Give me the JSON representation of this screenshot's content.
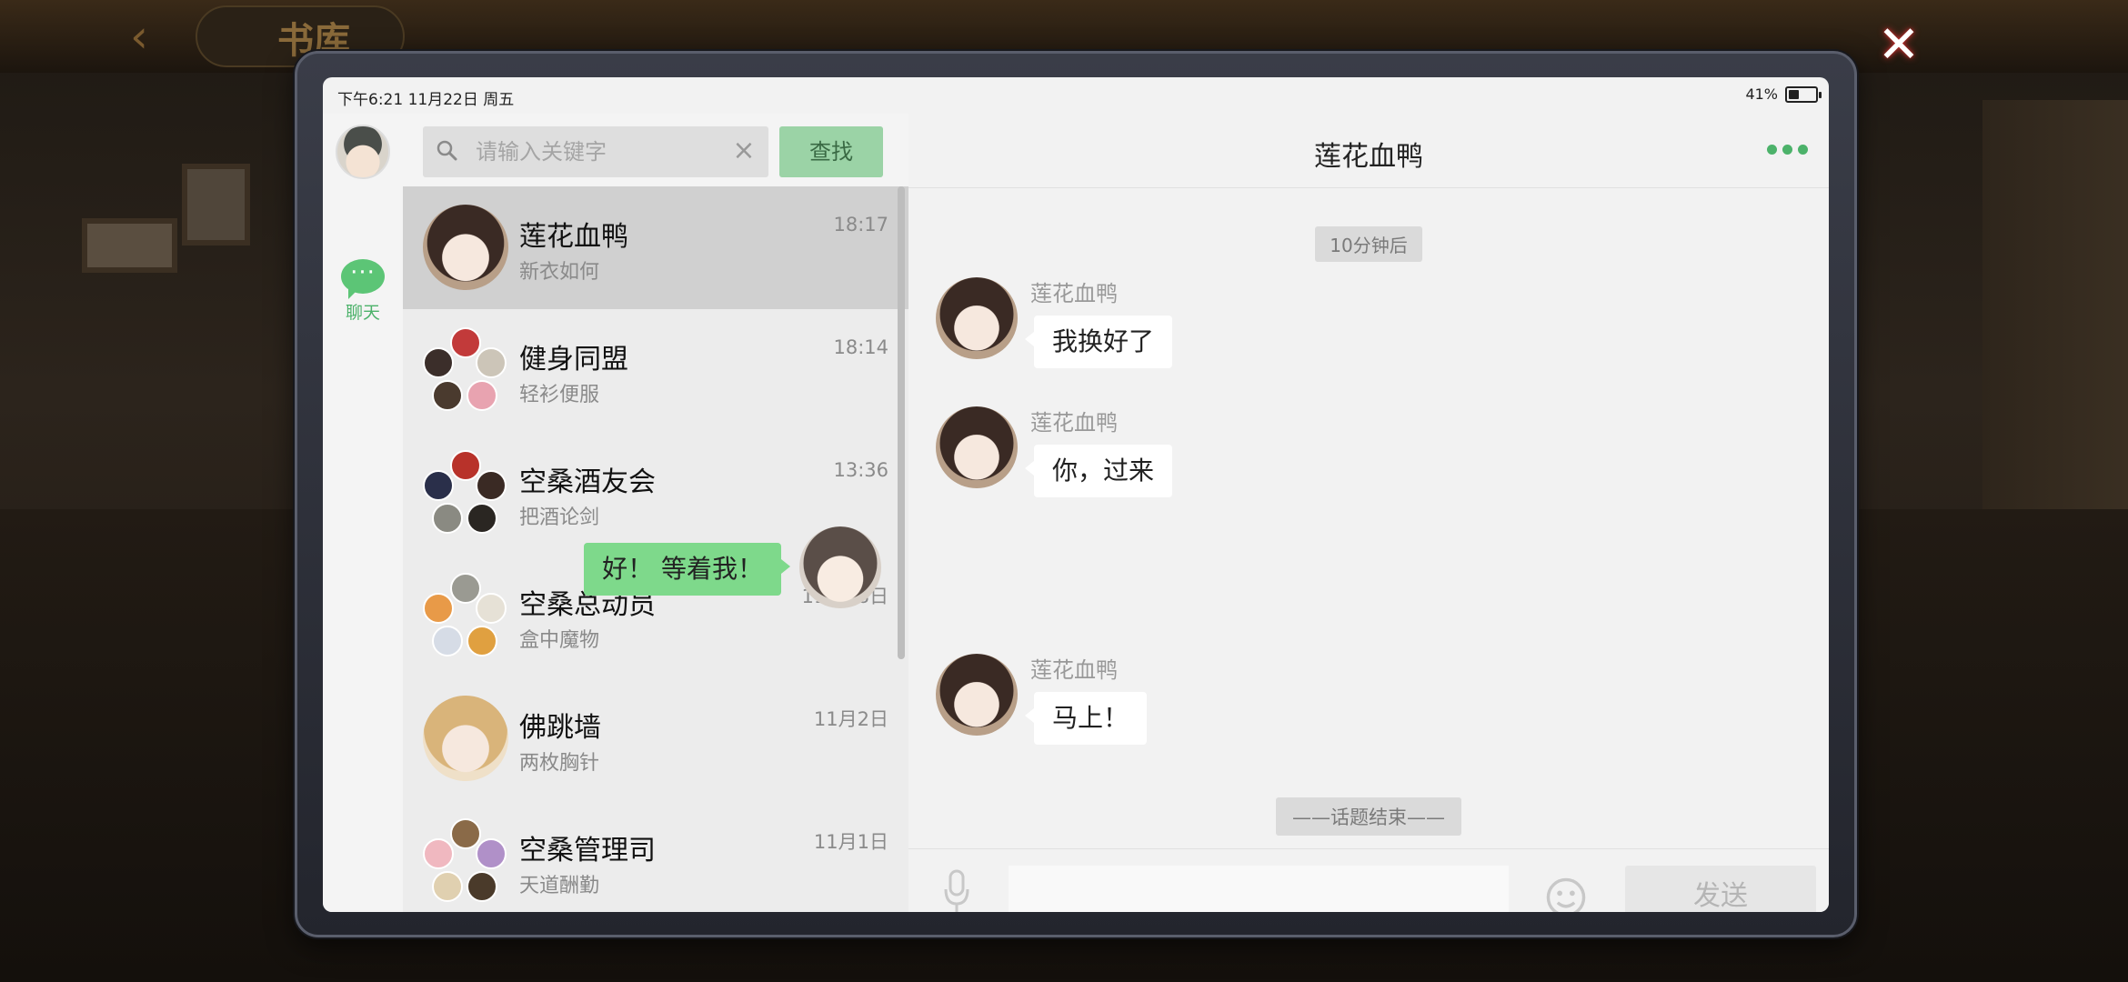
{
  "background": {
    "title": "书库"
  },
  "status": {
    "time": "下午6:21  11月22日  周五",
    "battery": "41%",
    "battery_level": 0.41
  },
  "rail": {
    "chat_label": "聊天"
  },
  "search": {
    "placeholder": "请输入关键字",
    "button": "查找"
  },
  "conversations": [
    {
      "name": "莲花血鸭",
      "preview": "新衣如何",
      "time": "18:17",
      "active": true
    },
    {
      "name": "健身同盟",
      "preview": "轻衫便服",
      "time": "18:14"
    },
    {
      "name": "空桑酒友会",
      "preview": "把酒论剑",
      "time": "13:36"
    },
    {
      "name": "空桑总动员",
      "preview": "盒中魔物",
      "time": "11月18日"
    },
    {
      "name": "佛跳墙",
      "preview": "两枚胸针",
      "time": "11月2日"
    },
    {
      "name": "空桑管理司",
      "preview": "天道酬勤",
      "time": "11月1日"
    }
  ],
  "chat": {
    "title": "莲花血鸭",
    "time_separator": "10分钟后",
    "messages": [
      {
        "from": "莲花血鸭",
        "text": "我换好了",
        "side": "left"
      },
      {
        "from": "莲花血鸭",
        "text": "你，过来",
        "side": "left"
      },
      {
        "from": "me",
        "text": "好！ 等着我！",
        "side": "right"
      },
      {
        "from": "莲花血鸭",
        "text": "马上！",
        "side": "left"
      }
    ],
    "end_separator": "——话题结束——",
    "send_button": "发送"
  },
  "colors": {
    "accent": "#5cc576",
    "my_bubble": "#7ed98b",
    "search_button": "#9bd3a6"
  }
}
